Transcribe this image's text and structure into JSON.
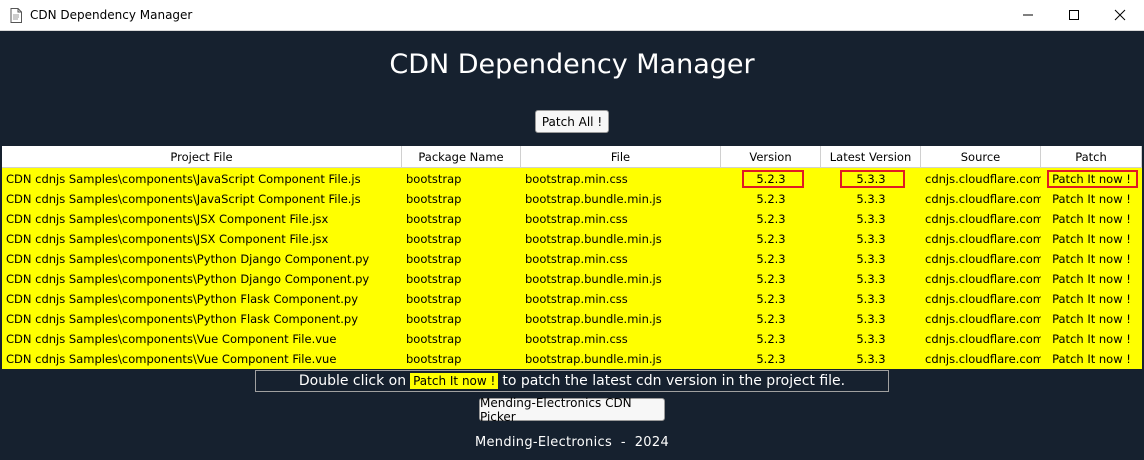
{
  "window": {
    "title": "CDN Dependency Manager",
    "icon": "document-icon"
  },
  "header": {
    "title": "CDN Dependency Manager"
  },
  "toolbar": {
    "patch_all_label": "Patch All !"
  },
  "table": {
    "columns": [
      "Project File",
      "Package Name",
      "File",
      "Version",
      "Latest Version",
      "Source",
      "Patch"
    ],
    "rows": [
      [
        "CDN cdnjs Samples\\components\\JavaScript Component File.js",
        "bootstrap",
        "bootstrap.min.css",
        "5.2.3",
        "5.3.3",
        "cdnjs.cloudflare.com",
        "Patch It now !"
      ],
      [
        "CDN cdnjs Samples\\components\\JavaScript Component File.js",
        "bootstrap",
        "bootstrap.bundle.min.js",
        "5.2.3",
        "5.3.3",
        "cdnjs.cloudflare.com",
        "Patch It now !"
      ],
      [
        "CDN cdnjs Samples\\components\\JSX Component File.jsx",
        "bootstrap",
        "bootstrap.min.css",
        "5.2.3",
        "5.3.3",
        "cdnjs.cloudflare.com",
        "Patch It now !"
      ],
      [
        "CDN cdnjs Samples\\components\\JSX Component File.jsx",
        "bootstrap",
        "bootstrap.bundle.min.js",
        "5.2.3",
        "5.3.3",
        "cdnjs.cloudflare.com",
        "Patch It now !"
      ],
      [
        "CDN cdnjs Samples\\components\\Python Django Component.py",
        "bootstrap",
        "bootstrap.min.css",
        "5.2.3",
        "5.3.3",
        "cdnjs.cloudflare.com",
        "Patch It now !"
      ],
      [
        "CDN cdnjs Samples\\components\\Python Django Component.py",
        "bootstrap",
        "bootstrap.bundle.min.js",
        "5.2.3",
        "5.3.3",
        "cdnjs.cloudflare.com",
        "Patch It now !"
      ],
      [
        "CDN cdnjs Samples\\components\\Python Flask Component.py",
        "bootstrap",
        "bootstrap.min.css",
        "5.2.3",
        "5.3.3",
        "cdnjs.cloudflare.com",
        "Patch It now !"
      ],
      [
        "CDN cdnjs Samples\\components\\Python Flask Component.py",
        "bootstrap",
        "bootstrap.bundle.min.js",
        "5.2.3",
        "5.3.3",
        "cdnjs.cloudflare.com",
        "Patch It now !"
      ],
      [
        "CDN cdnjs Samples\\components\\Vue Component File.vue",
        "bootstrap",
        "bootstrap.min.css",
        "5.2.3",
        "5.3.3",
        "cdnjs.cloudflare.com",
        "Patch It now !"
      ],
      [
        "CDN cdnjs Samples\\components\\Vue Component File.vue",
        "bootstrap",
        "bootstrap.bundle.min.js",
        "5.2.3",
        "5.3.3",
        "cdnjs.cloudflare.com",
        "Patch It now !"
      ]
    ]
  },
  "hint": {
    "prefix": "Double click on",
    "chip": "Patch It now !",
    "suffix": "to patch the latest cdn version in the project file."
  },
  "picker_button_label": "Mending-Electronics CDN Picker",
  "footer": "Mending-Electronics  -  2024",
  "colors": {
    "background": "#16212f",
    "row_highlight": "#ffff00",
    "annotation": "#e01b24"
  }
}
